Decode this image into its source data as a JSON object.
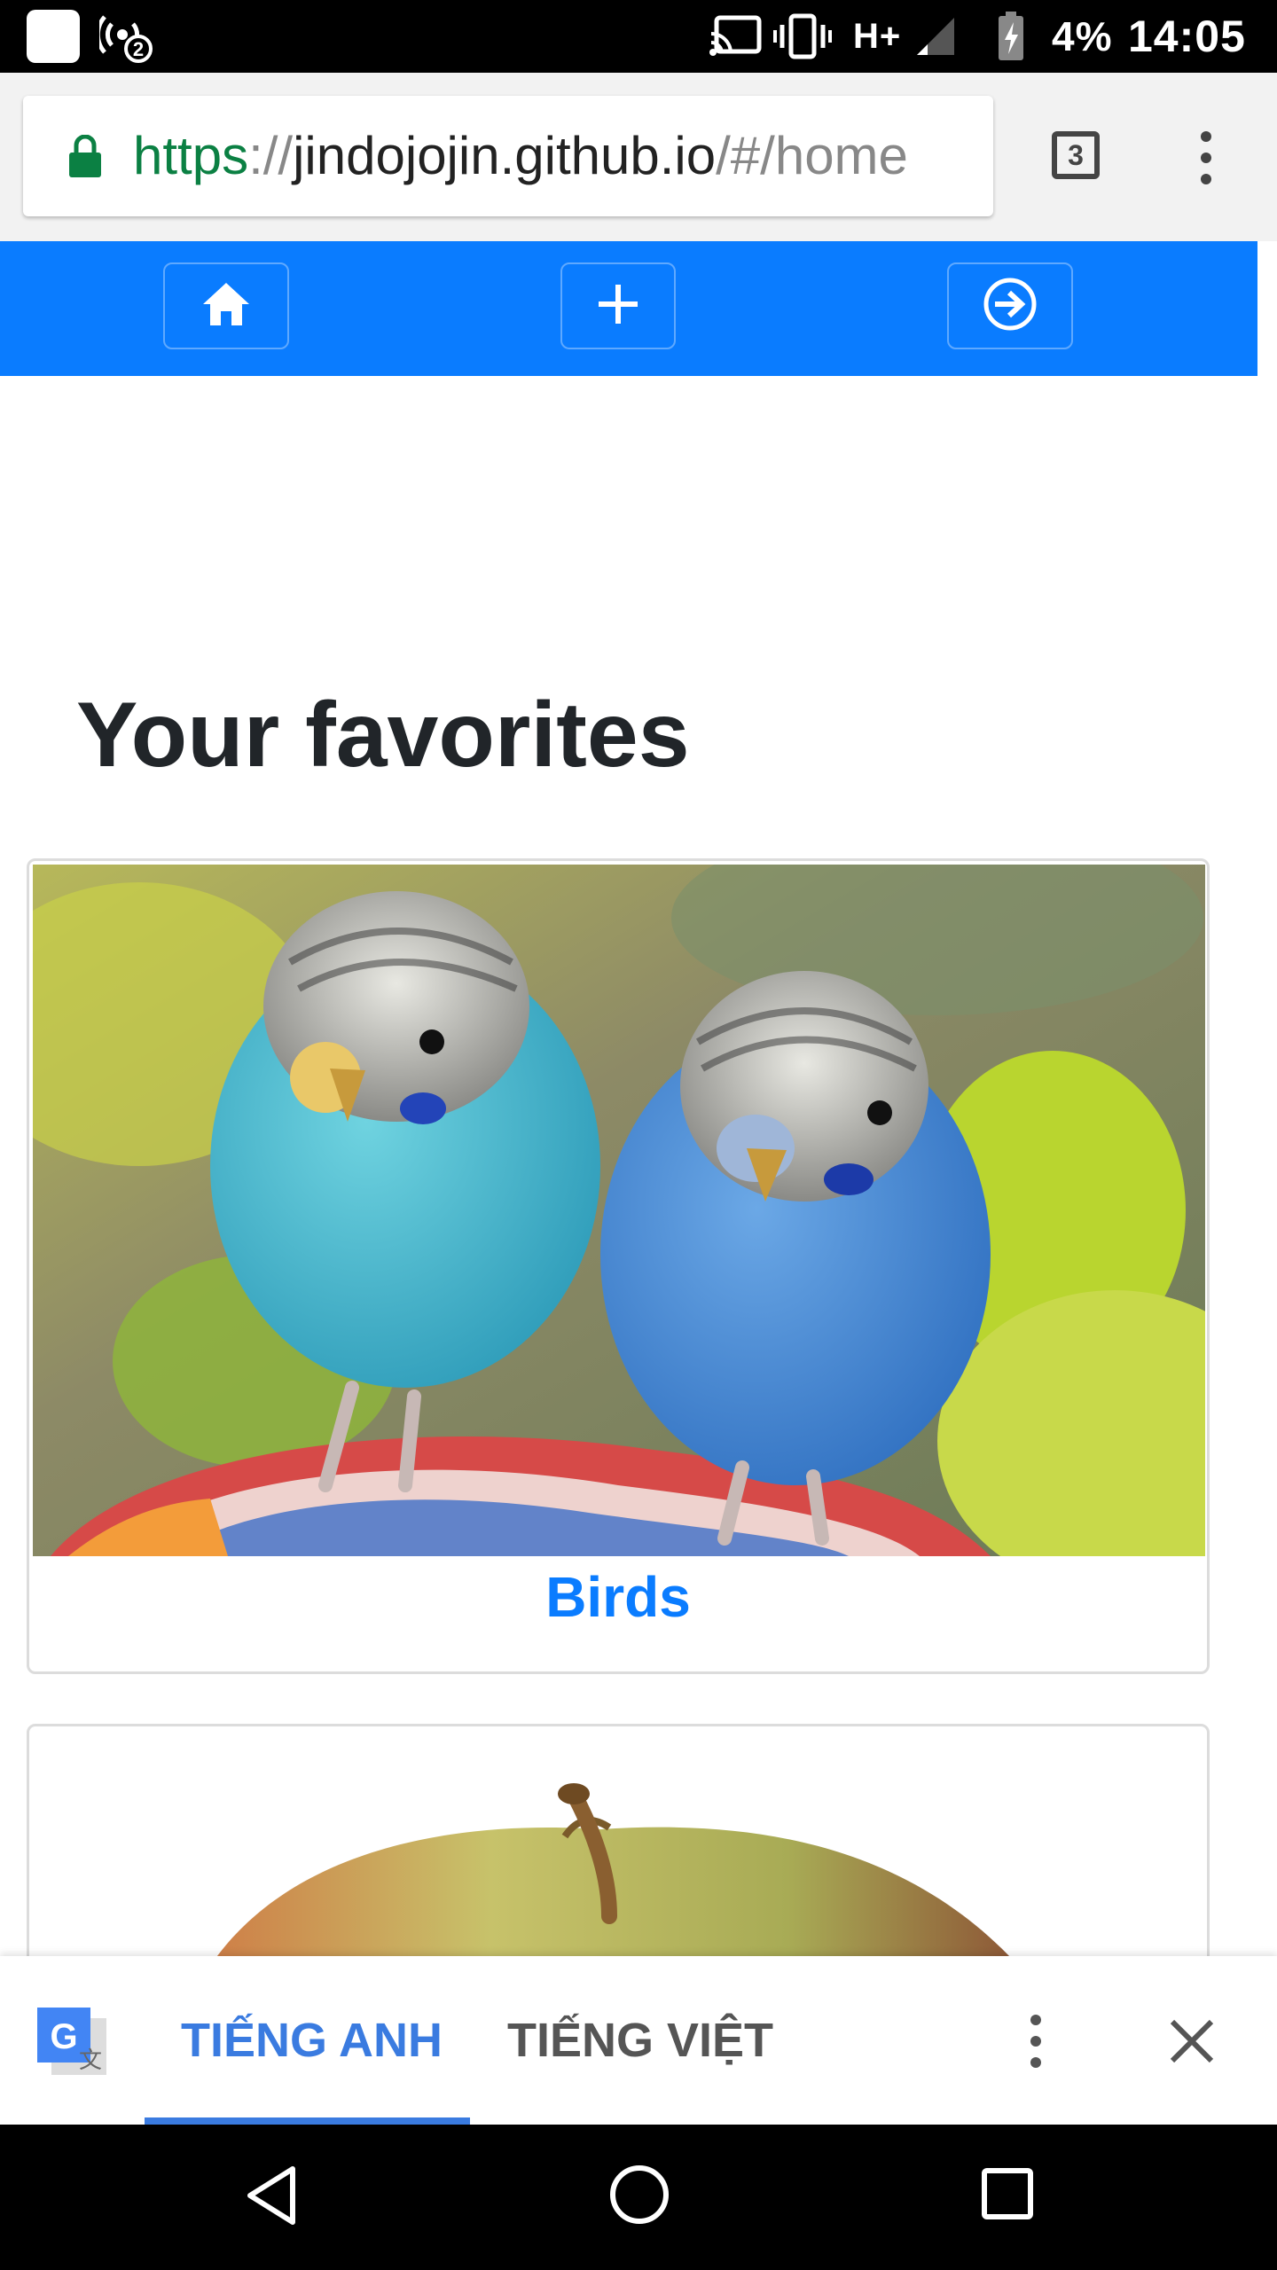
{
  "status_bar": {
    "notification_badge": "2",
    "network_type": "H+",
    "battery": "4%",
    "time": "14:05"
  },
  "browser": {
    "url_scheme": "https",
    "url_sep": "://",
    "url_host": "jindojojin.github.io",
    "url_path": "/#/home",
    "tab_count": "3"
  },
  "app_nav": {
    "items": [
      {
        "icon": "home-icon"
      },
      {
        "icon": "plus-icon"
      },
      {
        "icon": "sign-in-icon"
      }
    ],
    "background_color": "#0a7cff"
  },
  "main": {
    "heading": "Your favorites",
    "cards": [
      {
        "title": "Birds",
        "image": "budgies-photo"
      },
      {
        "title": "",
        "image": "apple-photo"
      }
    ]
  },
  "translate_bar": {
    "source_language": "TIẾNG ANH",
    "target_language": "TIẾNG VIỆT",
    "accent_color": "#3a7be0"
  },
  "android_nav": {
    "buttons": [
      "back-icon",
      "home-circle-icon",
      "recents-icon"
    ]
  }
}
